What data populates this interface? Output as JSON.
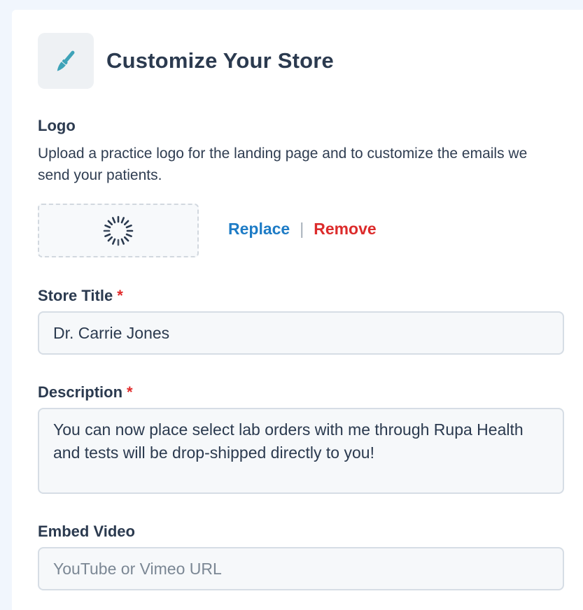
{
  "header": {
    "title": "Customize Your Store",
    "icon": "paintbrush-icon"
  },
  "logo": {
    "label": "Logo",
    "helper": "Upload a practice logo for the landing page and to customize the emails we send your patients.",
    "replace_label": "Replace",
    "divider": "|",
    "remove_label": "Remove"
  },
  "store_title": {
    "label": "Store Title",
    "required_mark": "*",
    "value": "Dr. Carrie Jones"
  },
  "description": {
    "label": "Description",
    "required_mark": "*",
    "value": "You can now place select lab orders with me through Rupa Health and tests will be drop-shipped directly to you!"
  },
  "embed_video": {
    "label": "Embed Video",
    "placeholder": "YouTube or Vimeo URL",
    "value": ""
  },
  "colors": {
    "accent_link": "#1e7cc6",
    "danger": "#dc2b2b",
    "icon_teal": "#3ea3b8"
  }
}
